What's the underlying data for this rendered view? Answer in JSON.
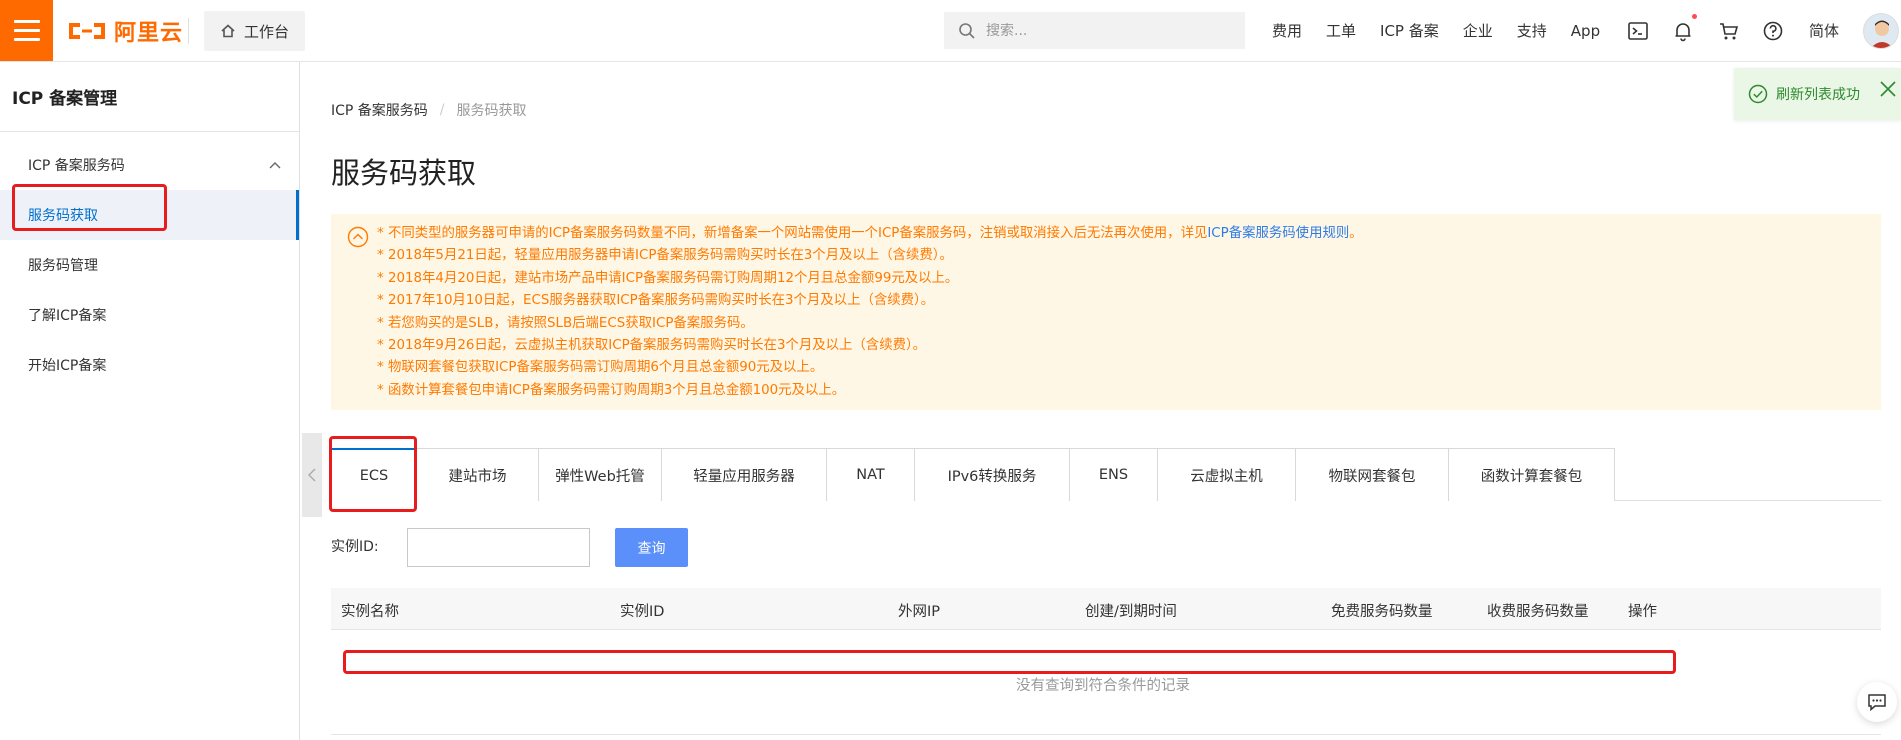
{
  "colors": {
    "brand": "#ff6a00",
    "primary": "#0070cc",
    "button": "#5b8ff9",
    "notice_text": "#ff7a00",
    "notice_bg": "#fff7e6",
    "highlight_box": "#e81c1c",
    "success": "#2f8a2f"
  },
  "topbar": {
    "logo_text": "阿里云",
    "workbench_label": "工作台",
    "search_placeholder": "搜索...",
    "nav": [
      "费用",
      "工单",
      "ICP 备案",
      "企业",
      "支持",
      "App"
    ],
    "icons": [
      "terminal-icon",
      "bell-icon",
      "cart-icon",
      "help-icon"
    ],
    "language": "简体"
  },
  "sidebar": {
    "title": "ICP 备案管理",
    "group_label": "ICP 备案服务码",
    "items": [
      {
        "label": "服务码获取",
        "active": true
      },
      {
        "label": "服务码管理",
        "active": false
      },
      {
        "label": "了解ICP备案",
        "active": false
      },
      {
        "label": "开始ICP备案",
        "active": false
      }
    ]
  },
  "breadcrumb": {
    "parent": "ICP 备案服务码",
    "separator": "/",
    "current": "服务码获取"
  },
  "page_title": "服务码获取",
  "notice": {
    "first_line_prefix": "* 不同类型的服务器可申请的ICP备案服务码数量不同，新增备案一个网站需使用一个ICP备案服务码，注销或取消接入后无法再次使用，详见",
    "first_line_link": "ICP备案服务码使用规则",
    "first_line_suffix": "。",
    "lines": [
      "* 2018年5月21日起，轻量应用服务器申请ICP备案服务码需购买时长在3个月及以上（含续费）。",
      "* 2018年4月20日起，建站市场产品申请ICP备案服务码需订购周期12个月且总金额99元及以上。",
      "* 2017年10月10日起，ECS服务器获取ICP备案服务码需购买时长在3个月及以上（含续费）。",
      "* 若您购买的是SLB，请按照SLB后端ECS获取ICP备案服务码。",
      "* 2018年9月26日起，云虚拟主机获取ICP备案服务码需购买时长在3个月及以上（含续费）。",
      "* 物联网套餐包获取ICP备案服务码需订购周期6个月且总金额90元及以上。",
      "* 函数计算套餐包申请ICP备案服务码需订购周期3个月且总金额100元及以上。"
    ]
  },
  "tabs": [
    "ECS",
    "建站市场",
    "弹性Web托管",
    "轻量应用服务器",
    "NAT",
    "IPv6转换服务",
    "ENS",
    "云虚拟主机",
    "物联网套餐包",
    "函数计算套餐包"
  ],
  "filter": {
    "label": "实例ID:",
    "value": "",
    "button": "查询"
  },
  "table": {
    "columns": [
      "实例名称",
      "实例ID",
      "外网IP",
      "创建/到期时间",
      "免费服务码数量",
      "收费服务码数量",
      "操作"
    ],
    "empty_text": "没有查询到符合条件的记录"
  },
  "toast": {
    "text": "刷新列表成功"
  }
}
